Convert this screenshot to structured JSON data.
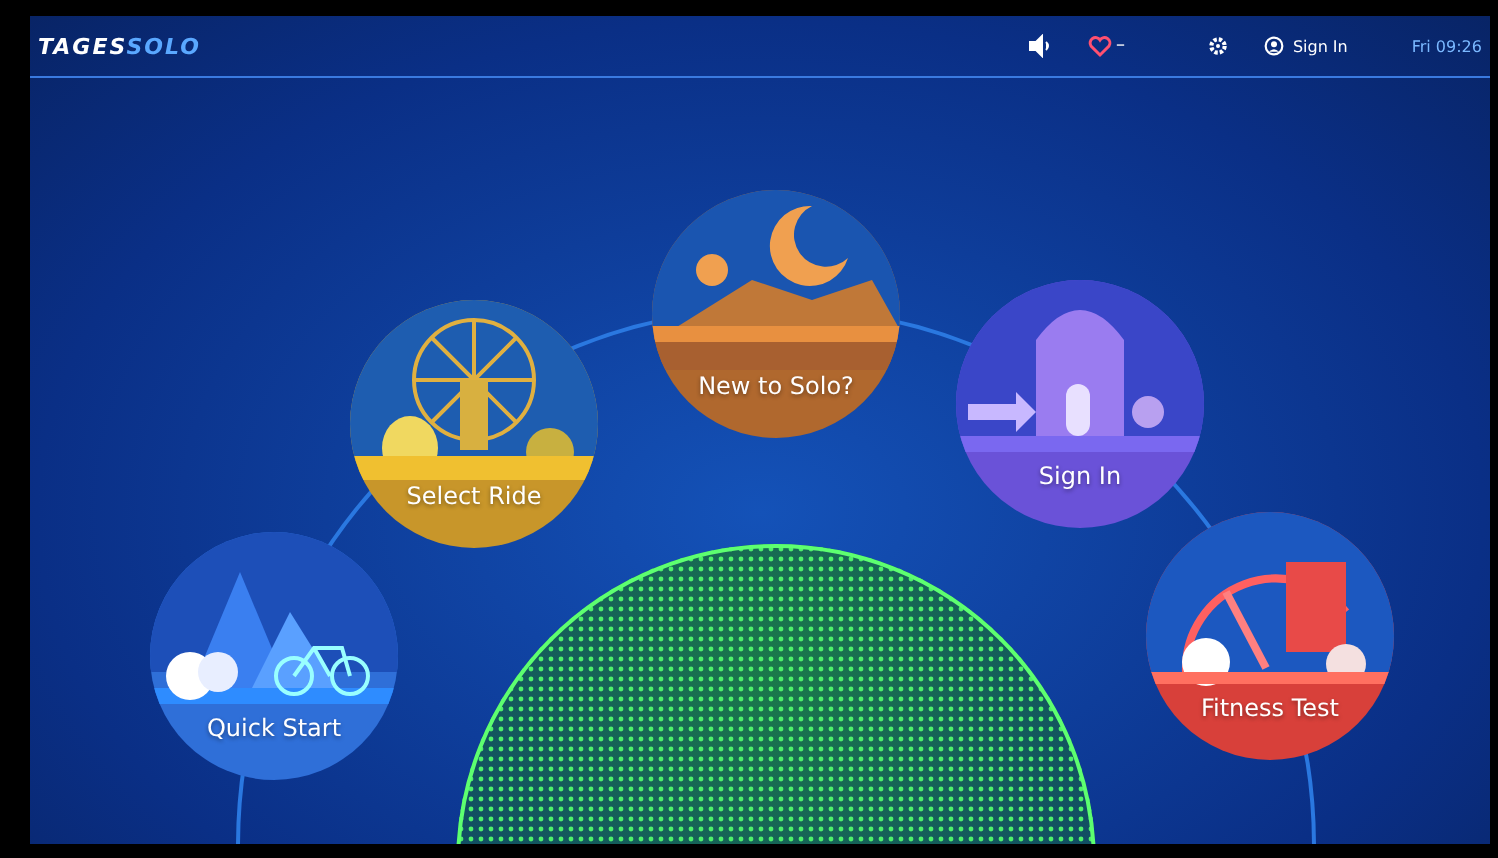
{
  "top_bar": {
    "logo": {
      "first": "TAGES",
      "second": "SOLO"
    },
    "heart_value": "–",
    "sign_in": "Sign In",
    "clock": "Fri 09:26"
  },
  "tiles": [
    {
      "label": "Quick Start",
      "kind": "bike",
      "color": "#2f6fd8"
    },
    {
      "label": "Select Ride",
      "kind": "wheel",
      "color": "#c8962a"
    },
    {
      "label": "New to Solo?",
      "kind": "desert",
      "color": "#b0682e"
    },
    {
      "label": "Sign In",
      "kind": "door",
      "color": "#6a52d8"
    },
    {
      "label": "Fitness Test",
      "kind": "gauge",
      "color": "#d8403a"
    }
  ]
}
